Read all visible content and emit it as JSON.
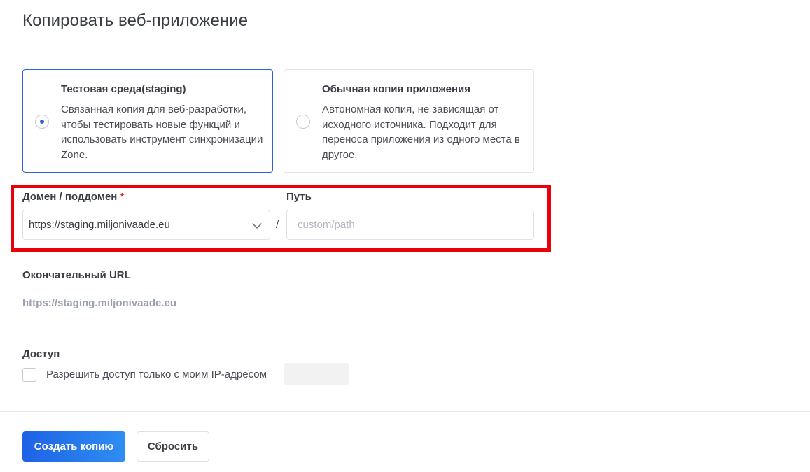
{
  "header": {
    "title": "Копировать веб-приложение"
  },
  "copy_options": [
    {
      "title": "Тестовая среда(staging)",
      "description": "Связанная копия для веб-разработки, чтобы тестировать новые функций и использовать инструмент синхронизации Zone.",
      "selected": true
    },
    {
      "title": "Обычная копия приложения",
      "description": "Автономная копия, не зависящая от исходного источника. Подходит для переноса приложения из одного места в другое.",
      "selected": false
    }
  ],
  "domain": {
    "label": "Домен / поддомен",
    "required_mark": "*",
    "selected_value": "https://staging.miljonivaade.eu"
  },
  "separator": "/",
  "path": {
    "label": "Путь",
    "placeholder": "custom/path",
    "value": ""
  },
  "final_url": {
    "label": "Окончательный URL",
    "value": "https://staging.miljonivaade.eu"
  },
  "access": {
    "label": "Доступ",
    "checkbox_label": "Разрешить доступ только с моим IP-адресом",
    "checked": false
  },
  "actions": {
    "submit_label": "Создать копию",
    "reset_label": "Сбросить"
  },
  "colors": {
    "accent": "#2f62d9",
    "highlight": "#e8000b",
    "required": "#e0342b",
    "final_url_text": "#9aa0b0"
  },
  "icons": {
    "select_chevron": "chevron-down-icon"
  }
}
